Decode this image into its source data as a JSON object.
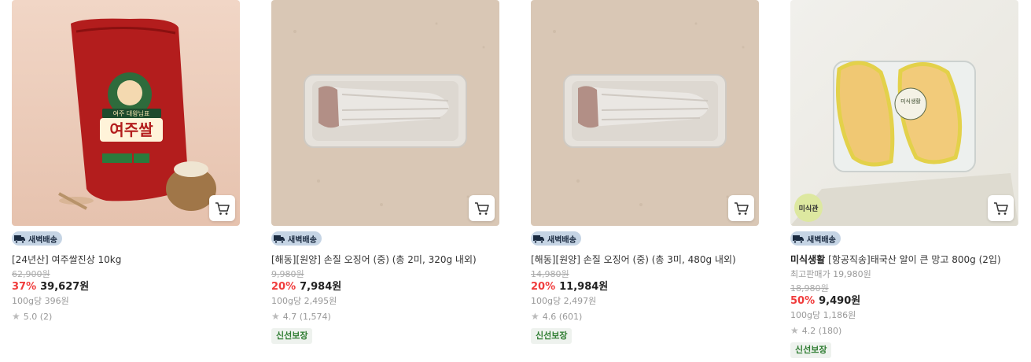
{
  "products": [
    {
      "badge": "새벽배송",
      "brand": "",
      "title": "[24년산] 여주쌀진상 10kg",
      "note": "",
      "original_price": "62,900원",
      "discount": "37%",
      "price": "39,627원",
      "per100": "100g당 396원",
      "rating": "5.0 (2)",
      "fresh": "",
      "image": "rice-bag",
      "tag_circle": "",
      "package_text": "여주쌀",
      "package_sub": "여주 대왕님표"
    },
    {
      "badge": "새벽배송",
      "brand": "",
      "title": "[해동][원양] 손질 오징어 (중) (총 2미, 320g 내외)",
      "note": "",
      "original_price": "9,980원",
      "discount": "20%",
      "price": "7,984원",
      "per100": "100g당 2,495원",
      "rating": "4.7 (1,574)",
      "fresh": "신선보장",
      "image": "squid-tray",
      "tag_circle": ""
    },
    {
      "badge": "새벽배송",
      "brand": "",
      "title": "[해동][원양] 손질 오징어 (중) (총 3미, 480g 내외)",
      "note": "",
      "original_price": "14,980원",
      "discount": "20%",
      "price": "11,984원",
      "per100": "100g당 2,497원",
      "rating": "4.6 (601)",
      "fresh": "신선보장",
      "image": "squid-tray",
      "tag_circle": ""
    },
    {
      "badge": "새벽배송",
      "brand": "미식생활",
      "title": "[항공직송]태국산 알이 큰 망고 800g (2입)",
      "note": "최고판매가 19,980원",
      "original_price": "18,980원",
      "discount": "50%",
      "price": "9,490원",
      "per100": "100g당 1,186원",
      "rating": "4.2 (180)",
      "fresh": "신선보장",
      "image": "mango-box",
      "tag_circle": "미식관",
      "package_text": "미식생활"
    }
  ],
  "colors": {
    "discount": "#f03c3c",
    "badge_bg": "#c5d4e4",
    "fresh_text": "#2f7d32"
  }
}
